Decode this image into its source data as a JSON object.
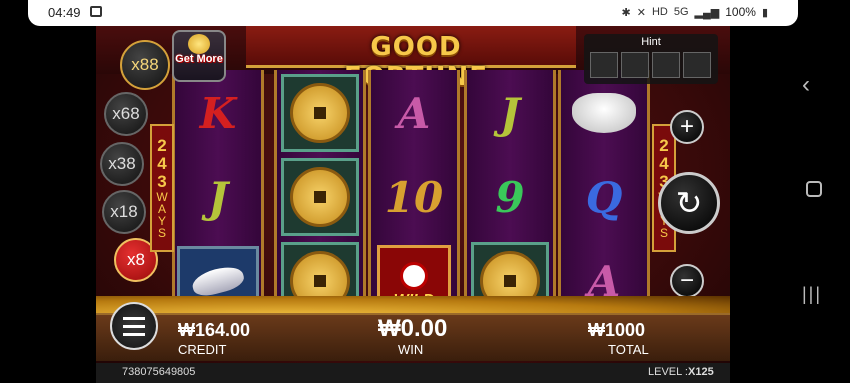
{
  "status_bar": {
    "time": "04:49",
    "hd": "HD",
    "net": "5G",
    "battery": "100%"
  },
  "game": {
    "title": "GOOD FORTUNE",
    "get_more": "Get More",
    "multipliers": [
      "x88",
      "x68",
      "x38",
      "x18",
      "x8"
    ],
    "active_multiplier": "x8",
    "ways_number": [
      "2",
      "4",
      "3"
    ],
    "ways_label": [
      "W",
      "A",
      "Y",
      "S"
    ],
    "hint_label": "Hint",
    "reels": [
      [
        "K",
        "J",
        "fish"
      ],
      [
        "coin",
        "coin",
        "coin"
      ],
      [
        "A",
        "10",
        "wild"
      ],
      [
        "J",
        "9",
        "coin"
      ],
      [
        "ingot",
        "Q",
        "A"
      ]
    ],
    "wild_label": "WILD",
    "credit_value": "₩164.00",
    "credit_label": "CREDIT",
    "win_value": "₩0.00",
    "win_label": "WIN",
    "total_value": "₩1000",
    "total_label": "TOTAL",
    "footer_id": "738075649805",
    "level_label": "LEVEL :",
    "level_value": "X125"
  }
}
